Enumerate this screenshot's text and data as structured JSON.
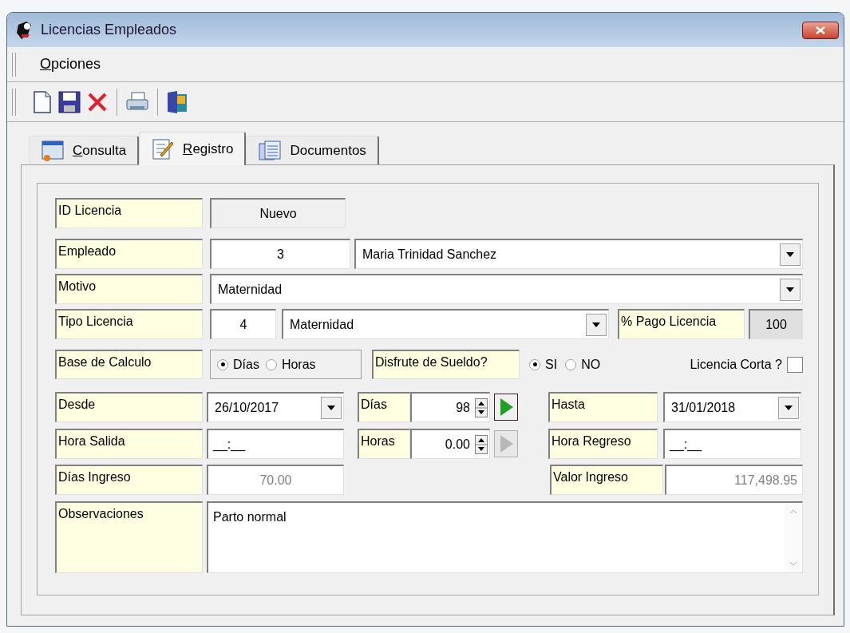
{
  "window": {
    "title": "Licencias Empleados"
  },
  "menu": [
    {
      "label": "Opciones",
      "underline_first": true
    }
  ],
  "toolbar": [
    {
      "kind": "new"
    },
    {
      "kind": "save"
    },
    {
      "kind": "delete"
    },
    {
      "kind": "separator"
    },
    {
      "kind": "print"
    },
    {
      "kind": "separator"
    },
    {
      "kind": "exit"
    }
  ],
  "tabs": [
    {
      "label": "Consulta",
      "kind": "query",
      "selected": false,
      "underline_first": true
    },
    {
      "label": "Registro",
      "kind": "edit",
      "selected": true,
      "underline_first": true
    },
    {
      "label": "Documentos",
      "kind": "documents",
      "selected": false,
      "underline_first": false
    }
  ],
  "form": {
    "id_licencia": {
      "label": "ID Licencia",
      "value": "Nuevo"
    },
    "empleado": {
      "label": "Empleado",
      "code": "3",
      "name": "Maria Trinidad Sanchez"
    },
    "motivo": {
      "label": "Motivo",
      "value": "Maternidad"
    },
    "tipo_licencia": {
      "label": "Tipo Licencia",
      "code": "4",
      "value": "Maternidad"
    },
    "pago_licencia": {
      "label": "% Pago Licencia",
      "value": "100"
    },
    "base_calculo": {
      "label": "Base de Calculo",
      "options": [
        {
          "label": "Días",
          "selected": true
        },
        {
          "label": "Horas",
          "selected": false
        }
      ]
    },
    "disfrute_sueldo": {
      "label": "Disfrute de Sueldo?",
      "options": [
        {
          "label": "SI",
          "selected": true
        },
        {
          "label": "NO",
          "selected": false
        }
      ]
    },
    "licencia_corta": {
      "label": "Licencia Corta ?",
      "checked": false
    },
    "desde": {
      "label": "Desde",
      "value": "26/10/2017"
    },
    "dias": {
      "label": "Días",
      "value": "98",
      "disabled": false
    },
    "hasta": {
      "label": "Hasta",
      "value": "31/01/2018"
    },
    "hora_salida": {
      "label": "Hora Salida",
      "value": "__:__"
    },
    "horas": {
      "label": "Horas",
      "value": "0.00",
      "disabled": true
    },
    "hora_regreso": {
      "label": "Hora Regreso",
      "value": "__:__"
    },
    "dias_ingreso": {
      "label": "Días Ingreso",
      "value": "70.00"
    },
    "valor_ingreso": {
      "label": "Valor Ingreso",
      "value": "117,498.95"
    },
    "observaciones": {
      "label": "Observaciones",
      "value": "Parto normal"
    }
  }
}
